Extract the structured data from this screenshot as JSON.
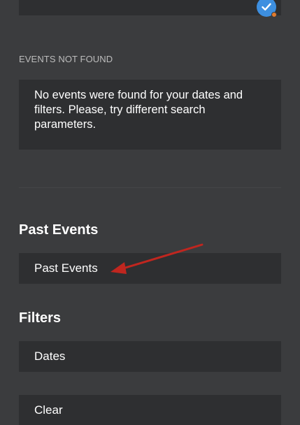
{
  "not_found": {
    "label": "EVENTS NOT FOUND",
    "message": "No events were found for your dates and filters. Please, try different search parameters."
  },
  "past_events": {
    "heading": "Past Events",
    "button_label": "Past Events"
  },
  "filters": {
    "heading": "Filters",
    "dates_label": "Dates",
    "clear_label": "Clear"
  },
  "colors": {
    "background": "#3b3c3e",
    "card": "#2e2f31",
    "accent_blue": "#3d8fe0",
    "annotation_arrow": "#c0261f"
  },
  "icons": {
    "check_badge": "check-circle-icon",
    "annotation": "red-arrow-annotation"
  }
}
